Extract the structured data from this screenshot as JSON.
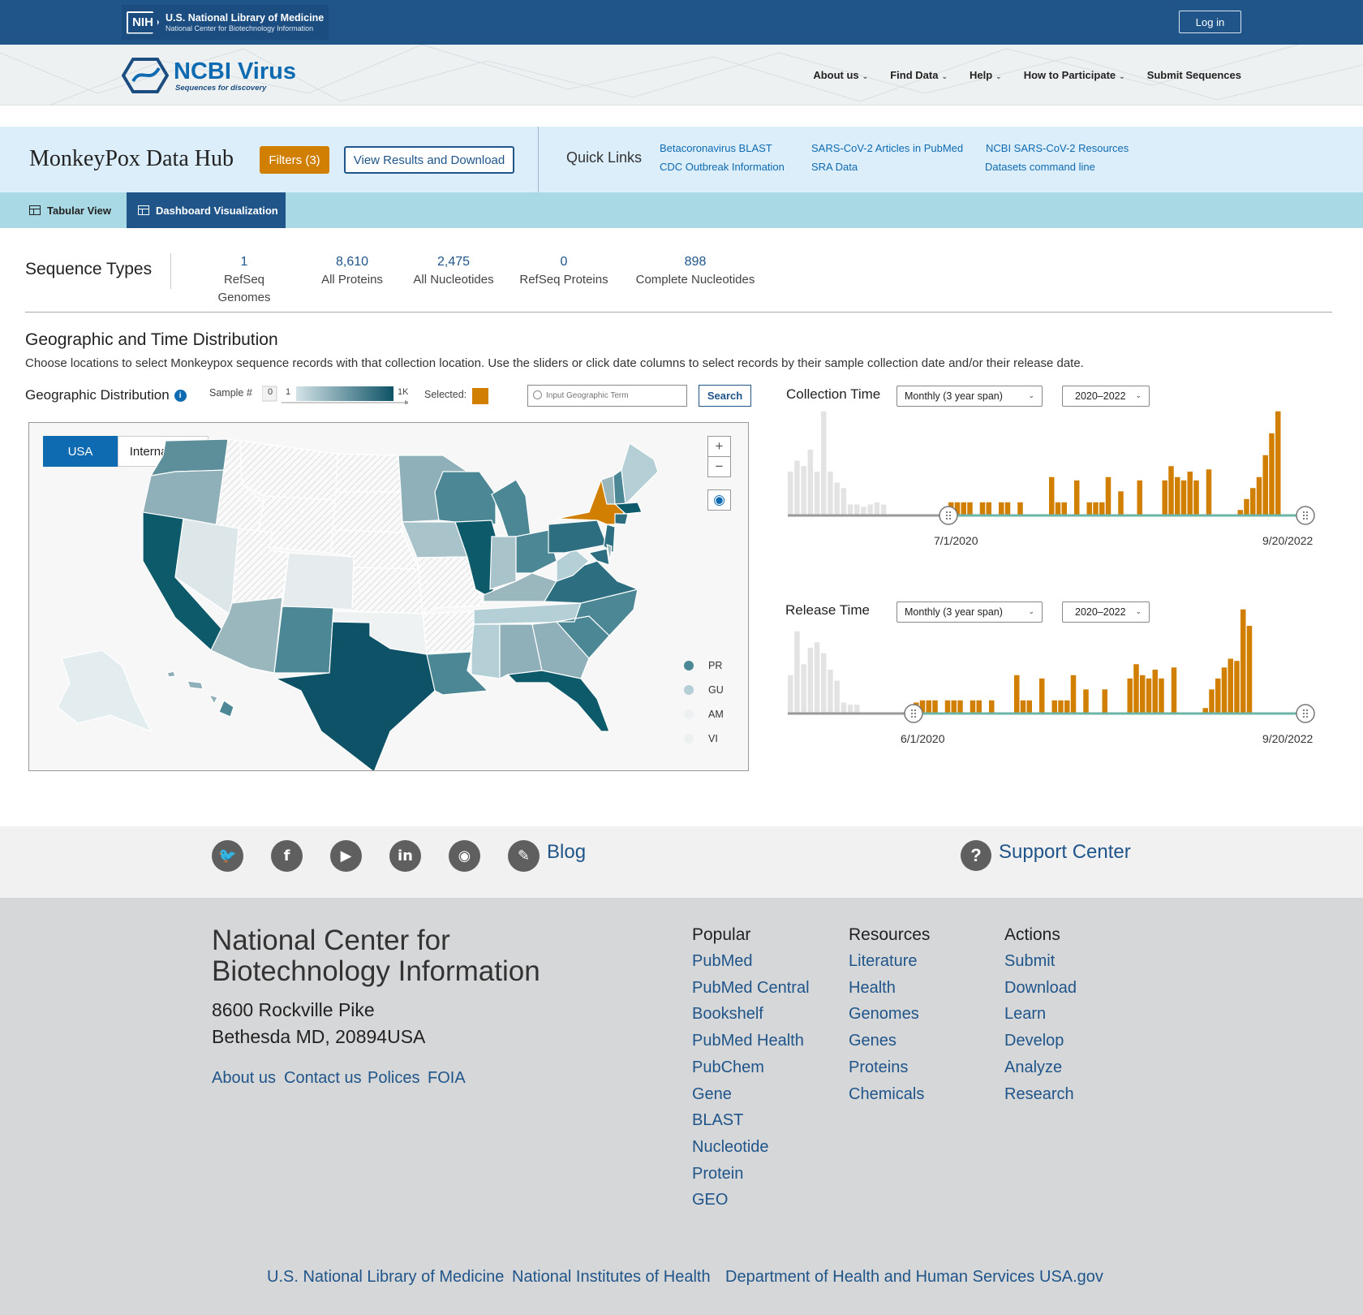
{
  "nih": {
    "badge": "NIH",
    "line1": "U.S. National Library of Medicine",
    "line2": "National Center for Biotechnology Information",
    "login": "Log in"
  },
  "brand": {
    "title": "NCBI Virus",
    "subtitle": "Sequences for discovery"
  },
  "topnav": [
    {
      "label": "About us",
      "dropdown": true
    },
    {
      "label": "Find Data",
      "dropdown": true
    },
    {
      "label": "Help",
      "dropdown": true
    },
    {
      "label": "How to Participate",
      "dropdown": true
    },
    {
      "label": "Submit Sequences",
      "dropdown": false
    }
  ],
  "hub": {
    "title": "MonkeyPox Data Hub",
    "filters": "Filters (3)",
    "results": "View Results and Download",
    "quick_links_title": "Quick Links"
  },
  "quick_links": [
    "Betacoronavirus BLAST",
    "CDC Outbreak Information",
    "SARS-CoV-2 Articles in PubMed",
    "SRA Data",
    "NCBI SARS-CoV-2 Resources",
    "Datasets command line"
  ],
  "tabs": {
    "tabular": "Tabular View",
    "dashboard": "Dashboard Visualization"
  },
  "sequence_types": {
    "title": "Sequence Types",
    "items": [
      {
        "count": "1",
        "label": "RefSeq Genomes"
      },
      {
        "count": "8,610",
        "label": "All Proteins"
      },
      {
        "count": "2,475",
        "label": "All Nucleotides"
      },
      {
        "count": "0",
        "label": "RefSeq Proteins"
      },
      {
        "count": "898",
        "label": "Complete Nucleotides"
      }
    ]
  },
  "geo": {
    "title": "Geographic and Time Distribution",
    "desc": "Choose locations to select Monkeypox sequence records with that collection location. Use the sliders or click date columns to select records by their sample collection date and/or their release date.",
    "dist_title": "Geographic Distribution",
    "info_icon": "i",
    "sample_label": "Sample #",
    "scale_zero": "0",
    "scale_min": "1",
    "scale_max": "1K",
    "selected_label": "Selected:",
    "selected_color": "#d17f00",
    "search_placeholder": "Input Geographic Term",
    "search_button": "Search",
    "map_tabs": {
      "usa": "USA",
      "intl": "International"
    },
    "zoom_in": "+",
    "zoom_out": "−",
    "territories": [
      {
        "code": "PR",
        "color": "#4b8795"
      },
      {
        "code": "GU",
        "color": "#b4cfd6"
      },
      {
        "code": "AM",
        "color": "#edf1f2"
      },
      {
        "code": "VI",
        "color": "#edf1f2"
      }
    ]
  },
  "collection_time": {
    "title": "Collection Time",
    "span": "Monthly (3 year span)",
    "years": "2020–2022",
    "start_label": "7/1/2020",
    "end_label": "9/20/2022",
    "chart_data": {
      "type": "bar",
      "grey_values": [
        0.4,
        0.5,
        0.45,
        0.6,
        0.4,
        0.95,
        0.4,
        0.3,
        0.25,
        0.1,
        0.1,
        0.08,
        0.1,
        0.12,
        0.1
      ],
      "orange_values": [
        0.12,
        0.12,
        0.12,
        0.12,
        0.0,
        0.12,
        0.12,
        0.0,
        0.12,
        0.12,
        0.0,
        0.12,
        0.0,
        0.0,
        0.0,
        0.0,
        0.35,
        0.12,
        0.12,
        0.0,
        0.32,
        0.0,
        0.12,
        0.12,
        0.12,
        0.35,
        0.0,
        0.22,
        0.0,
        0.0,
        0.32,
        0.0,
        0.0,
        0.0,
        0.32,
        0.45,
        0.35,
        0.32,
        0.4,
        0.32,
        0.0,
        0.42,
        0.0,
        0.0,
        0.0,
        0.0,
        0.05,
        0.15,
        0.25,
        0.35,
        0.55,
        0.75,
        0.95
      ]
    }
  },
  "release_time": {
    "title": "Release Time",
    "span": "Monthly (3 year span)",
    "years": "2020–2022",
    "start_label": "6/1/2020",
    "end_label": "9/20/2022",
    "chart_data": {
      "type": "bar",
      "grey_values": [
        0.35,
        0.75,
        0.45,
        0.6,
        0.65,
        0.55,
        0.4,
        0.3,
        0.1,
        0.08,
        0.08
      ],
      "orange_values": [
        0.1,
        0.12,
        0.12,
        0.12,
        0.0,
        0.12,
        0.12,
        0.12,
        0.0,
        0.12,
        0.12,
        0.0,
        0.12,
        0.0,
        0.0,
        0.0,
        0.35,
        0.12,
        0.12,
        0.0,
        0.32,
        0.0,
        0.12,
        0.12,
        0.12,
        0.35,
        0.0,
        0.22,
        0.0,
        0.0,
        0.22,
        0.0,
        0.0,
        0.0,
        0.32,
        0.45,
        0.35,
        0.32,
        0.4,
        0.32,
        0.0,
        0.42,
        0.0,
        0.0,
        0.0,
        0.0,
        0.05,
        0.22,
        0.32,
        0.42,
        0.5,
        0.48,
        0.95,
        0.8
      ]
    }
  },
  "social": {
    "blog": "Blog",
    "support": "Support Center"
  },
  "footer": {
    "org_name": "National Center for Biotechnology Information",
    "address1": "8600 Rockville Pike",
    "address2": "Bethesda MD, 20894USA",
    "links": [
      "About us",
      "Contact us",
      "Polices",
      "FOIA"
    ],
    "columns": [
      {
        "head": "Popular",
        "items": [
          "PubMed",
          "PubMed Central",
          "Bookshelf",
          "PubMed Health",
          "PubChem",
          "Gene",
          "BLAST",
          "Nucleotide",
          "Protein",
          "GEO"
        ]
      },
      {
        "head": "Resources",
        "items": [
          "Literature",
          "Health",
          "Genomes",
          "Genes",
          "Proteins",
          "Chemicals"
        ]
      },
      {
        "head": "Actions",
        "items": [
          "Submit",
          "Download",
          "Learn",
          "Develop",
          "Analyze",
          "Research"
        ]
      }
    ],
    "bottom": [
      "U.S. National Library of Medicine",
      "National Institutes of Health",
      "Department of Health and Human Services",
      "USA.gov"
    ]
  }
}
